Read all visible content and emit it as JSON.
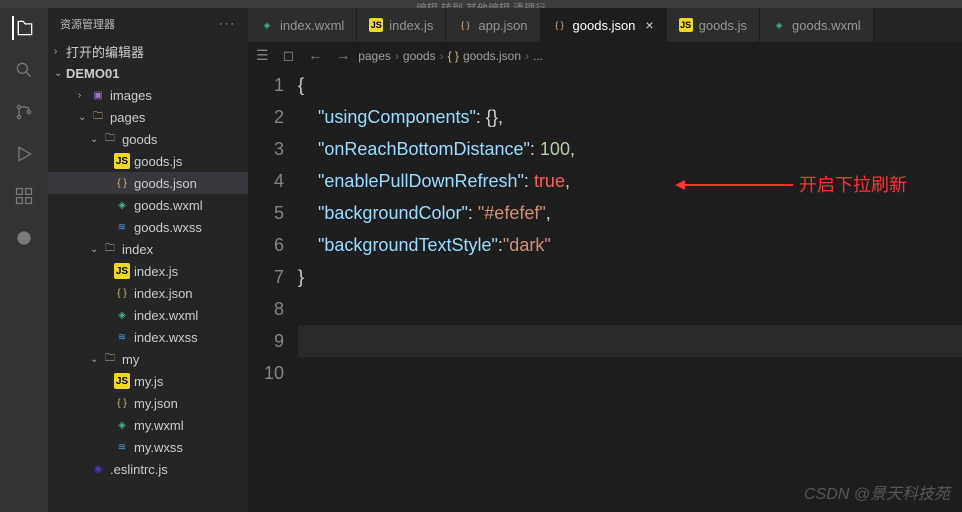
{
  "menu_hint": "编辑  转到  其他编辑  清理行",
  "sidebar": {
    "title": "资源管理器",
    "sections": {
      "open_editors": "打开的编辑器",
      "project": "DEMO01"
    },
    "tree": [
      {
        "label": "images",
        "icon": "img",
        "indent": 2,
        "chev": "›"
      },
      {
        "label": "pages",
        "icon": "folder-open",
        "indent": 2,
        "chev": "⌄"
      },
      {
        "label": "goods",
        "icon": "folder-open",
        "indent": 3,
        "chev": "⌄"
      },
      {
        "label": "goods.js",
        "icon": "js",
        "indent": 4
      },
      {
        "label": "goods.json",
        "icon": "json",
        "indent": 4,
        "selected": true
      },
      {
        "label": "goods.wxml",
        "icon": "wxml",
        "indent": 4
      },
      {
        "label": "goods.wxss",
        "icon": "wxss",
        "indent": 4
      },
      {
        "label": "index",
        "icon": "folder-open",
        "indent": 3,
        "chev": "⌄"
      },
      {
        "label": "index.js",
        "icon": "js",
        "indent": 4
      },
      {
        "label": "index.json",
        "icon": "json",
        "indent": 4
      },
      {
        "label": "index.wxml",
        "icon": "wxml",
        "indent": 4
      },
      {
        "label": "index.wxss",
        "icon": "wxss",
        "indent": 4
      },
      {
        "label": "my",
        "icon": "folder-open",
        "indent": 3,
        "chev": "⌄"
      },
      {
        "label": "my.js",
        "icon": "js",
        "indent": 4
      },
      {
        "label": "my.json",
        "icon": "json",
        "indent": 4
      },
      {
        "label": "my.wxml",
        "icon": "wxml",
        "indent": 4
      },
      {
        "label": "my.wxss",
        "icon": "wxss",
        "indent": 4
      },
      {
        "label": ".eslintrc.js",
        "icon": "eslint",
        "indent": 2
      }
    ]
  },
  "tabs": [
    {
      "label": "index.wxml",
      "icon": "wxml"
    },
    {
      "label": "index.js",
      "icon": "js"
    },
    {
      "label": "app.json",
      "icon": "json"
    },
    {
      "label": "goods.json",
      "icon": "json",
      "active": true,
      "close": true
    },
    {
      "label": "goods.js",
      "icon": "js"
    },
    {
      "label": "goods.wxml",
      "icon": "wxml"
    }
  ],
  "breadcrumb": [
    "pages",
    "goods",
    "goods.json",
    "..."
  ],
  "code": {
    "lines": [
      "1",
      "2",
      "3",
      "4",
      "5",
      "6",
      "7",
      "8",
      "9",
      "10"
    ],
    "content": {
      "k1": "\"usingComponents\"",
      "v1": "{}",
      "k2": "\"onReachBottomDistance\"",
      "v2": "100",
      "k3": "\"enablePullDownRefresh\"",
      "v3": "true",
      "k4": "\"backgroundColor\"",
      "v4": "\"#efefef\"",
      "k5": "\"backgroundTextStyle\"",
      "v5": "\"dark\""
    }
  },
  "annotation_text": "开启下拉刷新",
  "watermark": "CSDN @景天科技苑"
}
